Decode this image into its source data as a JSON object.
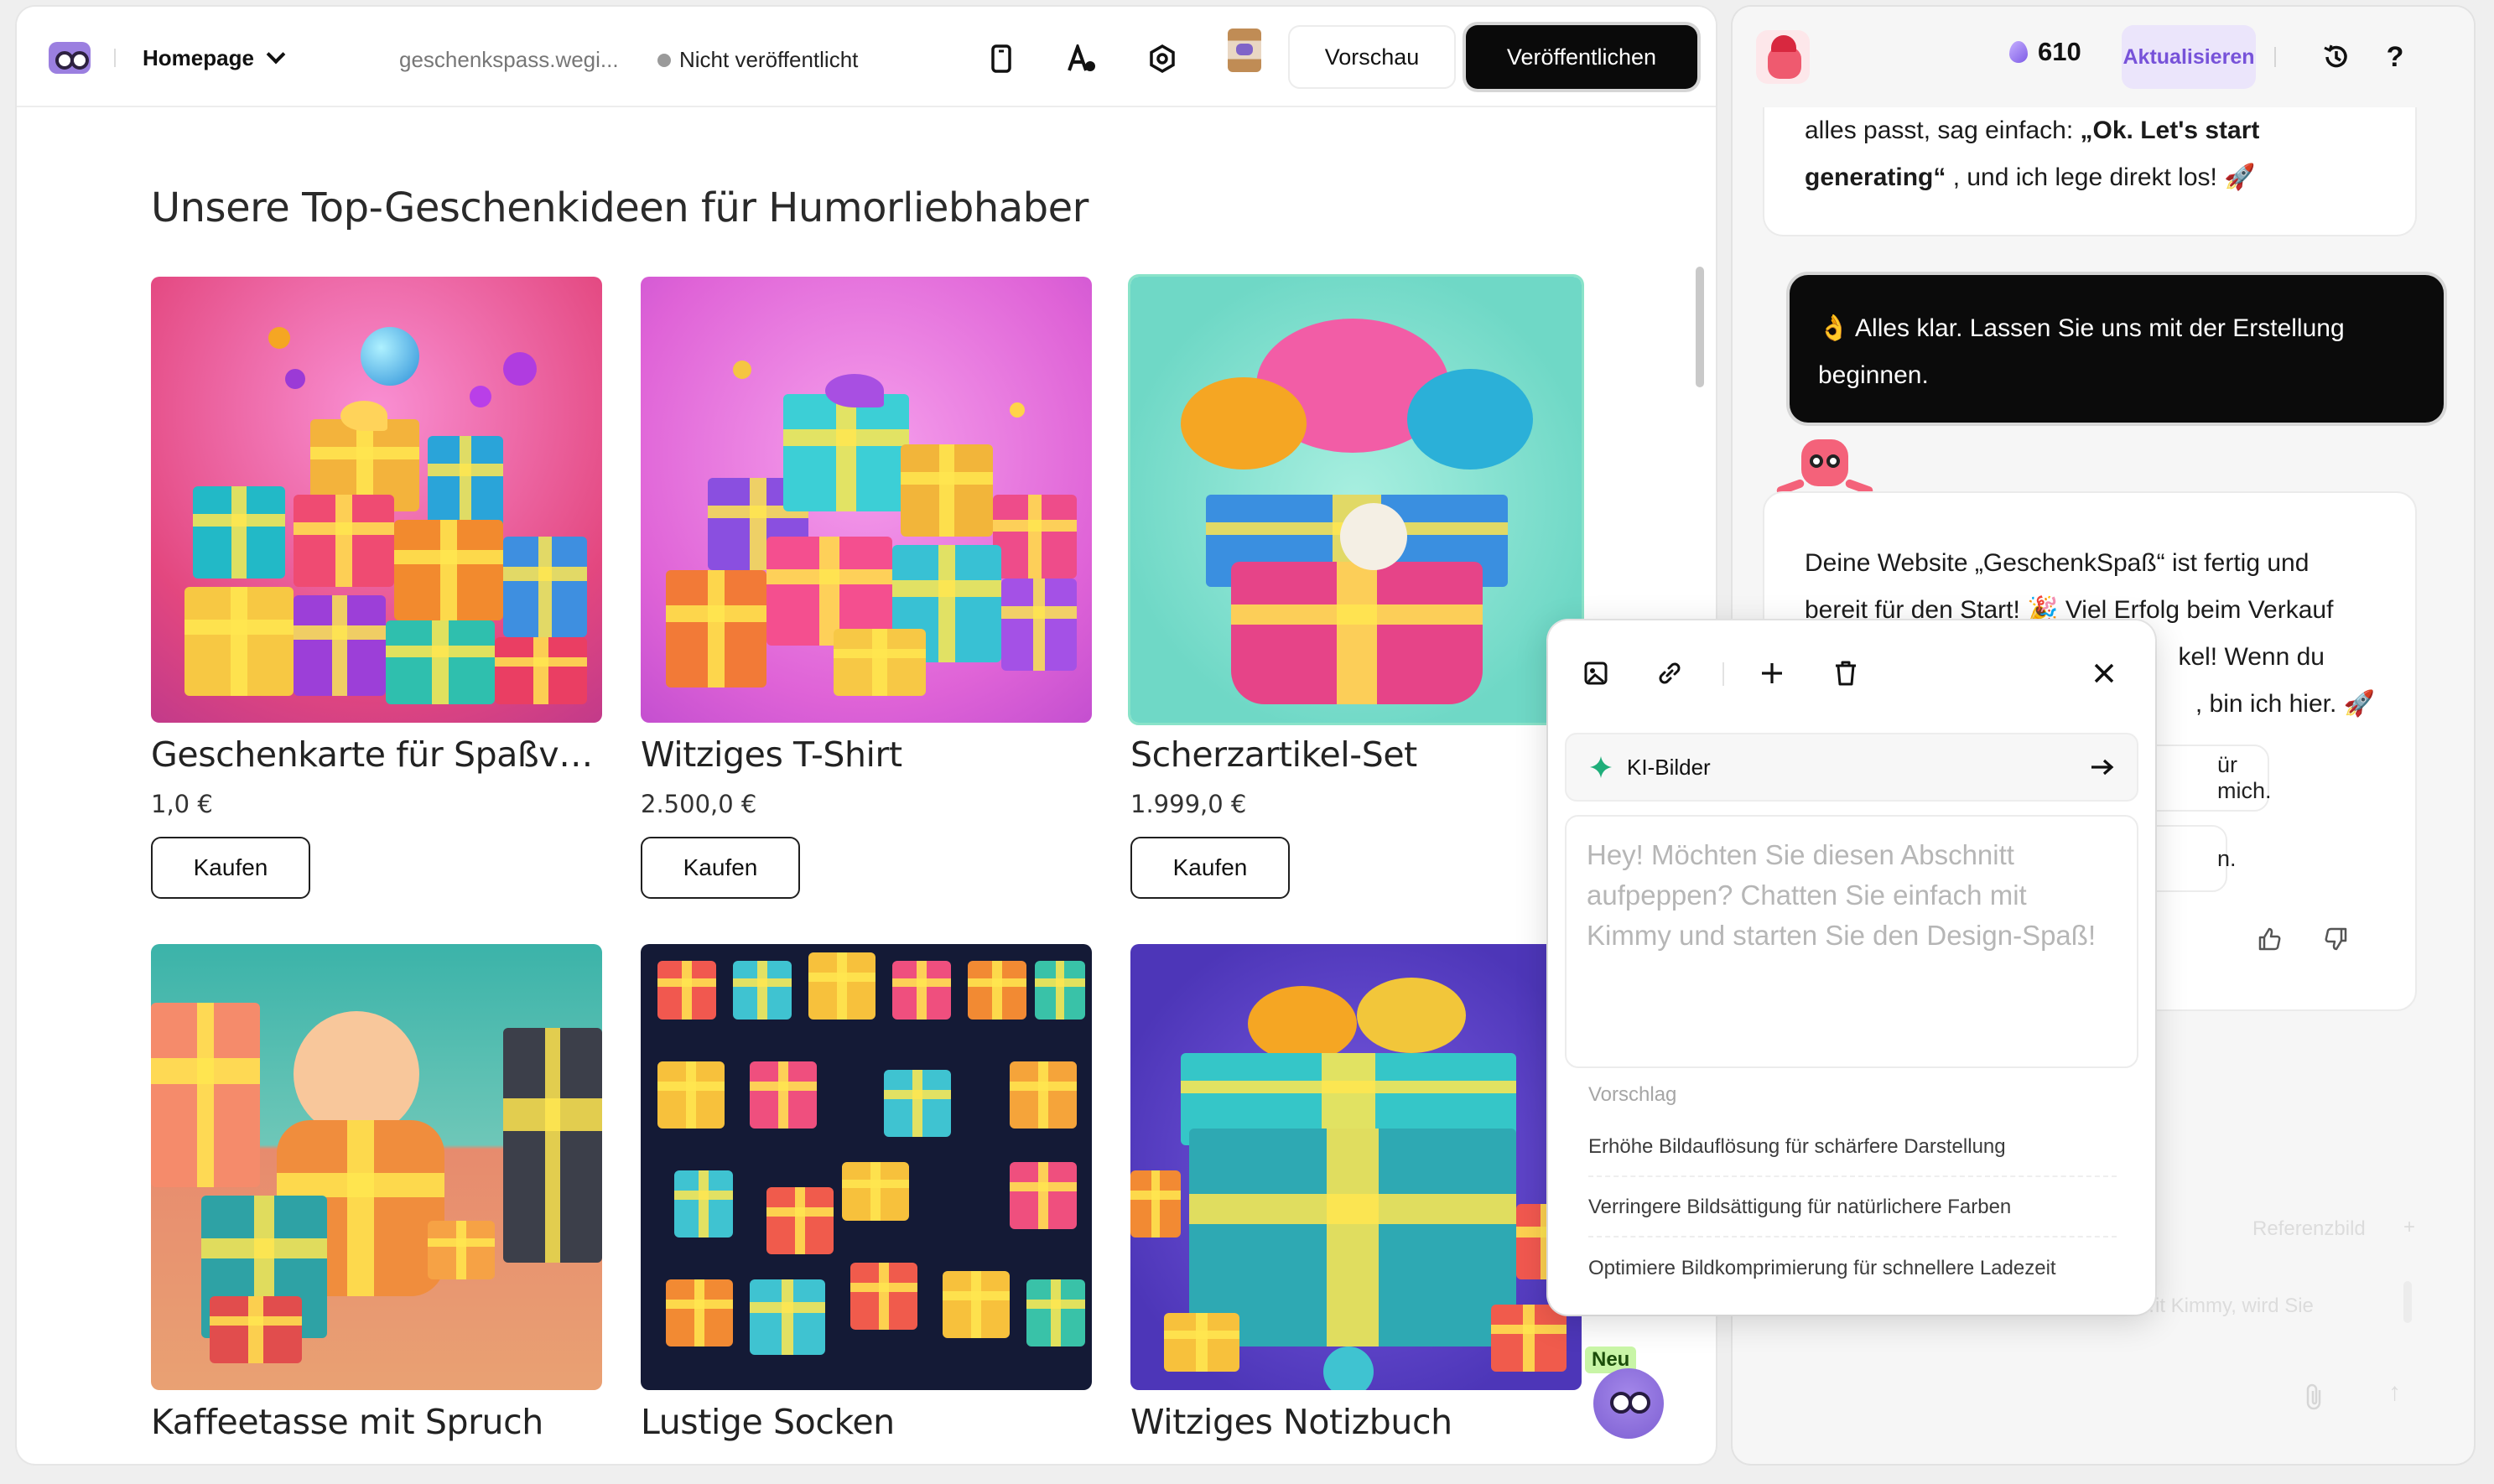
{
  "header": {
    "page_select_label": "Homepage",
    "domain": "geschenkspass.wegi...",
    "status": "Nicht veröffentlicht",
    "preview_label": "Vorschau",
    "publish_label": "Veröffentlichen"
  },
  "section": {
    "title": "Unsere Top-Geschenkideen für Humorliebhaber"
  },
  "products": [
    {
      "name": "Geschenkarte für Spaßvögel",
      "price": "1,0 €",
      "buy": "Kaufen"
    },
    {
      "name": "Witziges T-Shirt",
      "price": "2.500,0 €",
      "buy": "Kaufen"
    },
    {
      "name": "Scherzartikel-Set",
      "price": "1.999,0 €",
      "buy": "Kaufen"
    },
    {
      "name": "Kaffeetasse mit Spruch"
    },
    {
      "name": "Lustige Socken"
    },
    {
      "name": "Witziges Notizbuch"
    }
  ],
  "chat": {
    "credits": "610",
    "upgrade_label": "Aktualisieren",
    "msg1_prefix": "alles passt, sag einfach: ",
    "msg1_bold": "„Ok. Let's start generating“",
    "msg1_suffix": " , und ich lege direkt los! 🚀",
    "user_msg": "👌 Alles klar. Lassen Sie uns mit der Erstellung beginnen.",
    "msg2_line1": "Deine Website „GeschenkSpaß“ ist fertig und",
    "msg2_line2": "bereit für den Start! 🎉 Viel Erfolg beim Verkauf",
    "msg2_line3_end": "kel! Wenn du",
    "msg2_line4_end": ", bin ich hier. 🚀",
    "chip1": "ür mich.",
    "chip2": "n.",
    "ghost_ref": "Referenzbild",
    "ghost_input": "…it Kimmy, wird Sie"
  },
  "popup": {
    "ai_images_label": "KI-Bilder",
    "prompt_placeholder": "Hey! Möchten Sie diesen Abschnitt aufpeppen? Chatten Sie einfach mit Kimmy und starten Sie den Design-Spaß!",
    "suggestion_heading": "Vorschlag",
    "suggestions": [
      "Erhöhe Bildauflösung für schärfere Darstellung",
      "Verringere Bildsättigung für natürlichere Farben",
      "Optimiere Bildkomprimierung für schnellere Ladezeit"
    ]
  },
  "badge": {
    "new_label": "Neu"
  },
  "colors": {
    "publish_bg": "#0a0a0a",
    "upgrade_bg": "#ebe5fb",
    "upgrade_text": "#7752d9",
    "new_badge": "#c8f5a6"
  }
}
